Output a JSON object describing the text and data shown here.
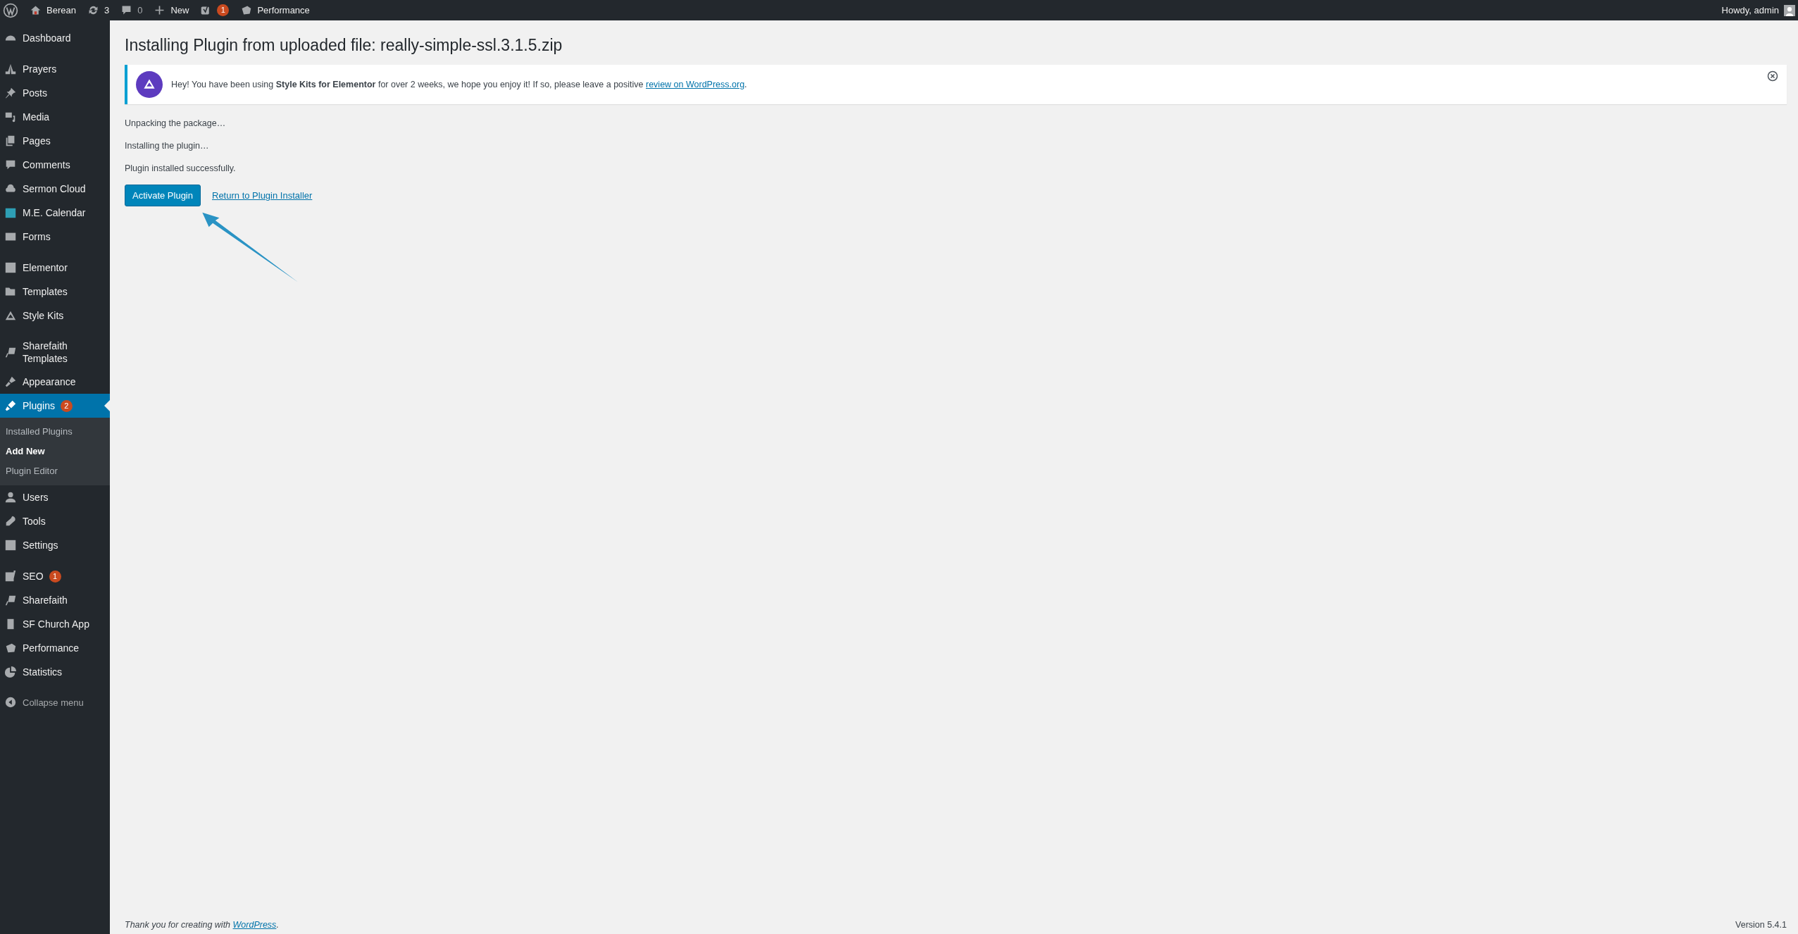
{
  "admin_bar": {
    "site": "Berean",
    "updates": "3",
    "comments": "0",
    "new": "New",
    "seo_badge": "1",
    "performance": "Performance",
    "greeting": "Howdy, admin"
  },
  "sidebar": {
    "groups": [
      [
        {
          "label": "Dashboard",
          "selected": false
        }
      ],
      [
        {
          "label": "Prayers",
          "selected": false
        },
        {
          "label": "Posts",
          "selected": false
        },
        {
          "label": "Media",
          "selected": false
        },
        {
          "label": "Pages",
          "selected": false
        },
        {
          "label": "Comments",
          "selected": false
        },
        {
          "label": "Sermon Cloud",
          "selected": false
        },
        {
          "label": "M.E. Calendar",
          "selected": false
        },
        {
          "label": "Forms",
          "selected": false
        }
      ],
      [
        {
          "label": "Elementor",
          "selected": false
        },
        {
          "label": "Templates",
          "selected": false
        },
        {
          "label": "Style Kits",
          "selected": false
        }
      ],
      [
        {
          "label": "Sharefaith Templates",
          "selected": false
        },
        {
          "label": "Appearance",
          "selected": false
        },
        {
          "label": "Plugins",
          "badge": "2",
          "selected": true,
          "submenu": [
            {
              "label": "Installed Plugins",
              "selected": false
            },
            {
              "label": "Add New",
              "selected": true
            },
            {
              "label": "Plugin Editor",
              "selected": false
            }
          ]
        },
        {
          "label": "Users",
          "selected": false
        },
        {
          "label": "Tools",
          "selected": false
        },
        {
          "label": "Settings",
          "selected": false
        }
      ],
      [
        {
          "label": "SEO",
          "badge": "1",
          "selected": false
        },
        {
          "label": "Sharefaith",
          "selected": false
        },
        {
          "label": "SF Church App",
          "selected": false
        },
        {
          "label": "Performance",
          "selected": false
        },
        {
          "label": "Statistics",
          "selected": false
        }
      ]
    ],
    "collapse": "Collapse menu"
  },
  "page": {
    "title": "Installing Plugin from uploaded file: really-simple-ssl.3.1.5.zip",
    "notice": {
      "text": "Hey! You have been using **Style Kits for Elementor** for over 2 weeks, we hope you enjoy it! If so, please leave a positive",
      "link": "review on WordPress.org",
      "after": "."
    },
    "messages": [
      "Unpacking the package…",
      "Installing the plugin…",
      "Plugin installed successfully."
    ],
    "primary_button": "Activate Plugin",
    "secondary_link": "Return to Plugin Installer"
  },
  "footer": {
    "text": "Thank you for creating with",
    "link": "WordPress",
    "after": ".",
    "version": "Version 5.4.1"
  }
}
